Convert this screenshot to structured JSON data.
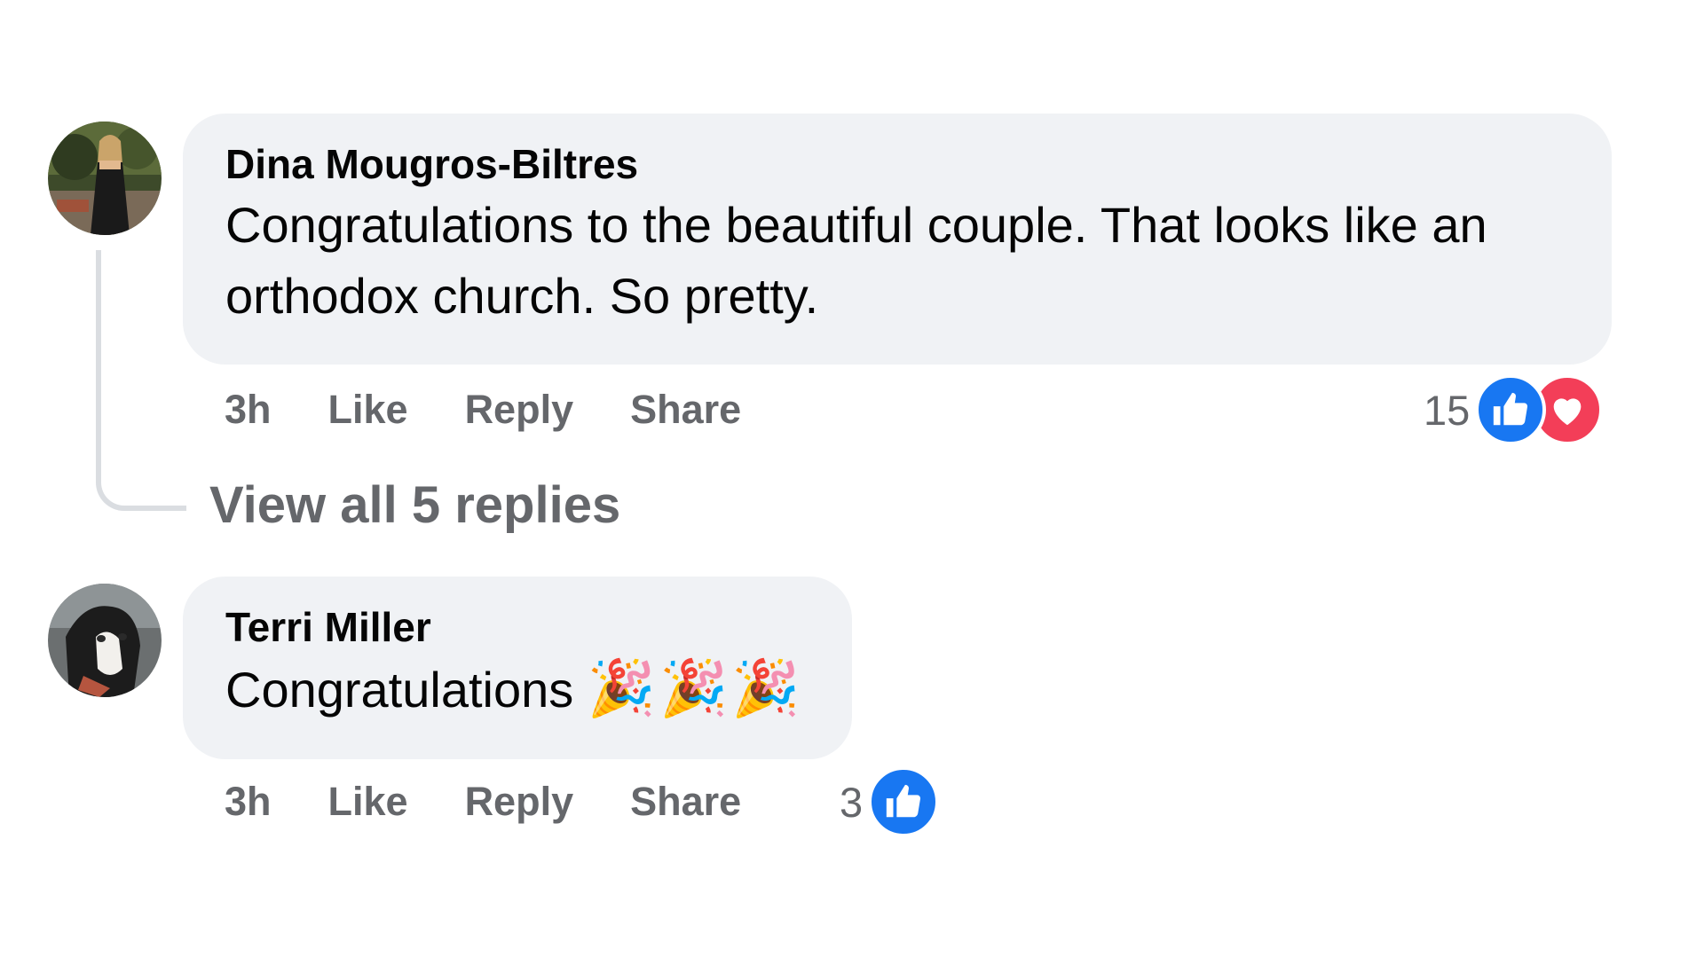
{
  "comments": [
    {
      "author": "Dina Mougros-Biltres",
      "text": "Congratulations to the beautiful couple. That looks like an orthodox church. So pretty.",
      "time": "3h",
      "actions": {
        "like": "Like",
        "reply": "Reply",
        "share": "Share"
      },
      "reaction_count": "15",
      "reactions": [
        "like-icon",
        "love-icon"
      ],
      "view_replies_label": "View all 5 replies"
    },
    {
      "author": "Terri Miller",
      "text": "Congratulations",
      "emoji": "🎉🎉🎉",
      "time": "3h",
      "actions": {
        "like": "Like",
        "reply": "Reply",
        "share": "Share"
      },
      "reaction_count": "3",
      "reactions": [
        "like-icon"
      ]
    }
  ],
  "colors": {
    "bubble": "#f0f2f5",
    "secondary_text": "#65676b",
    "like_blue": "#1877f2",
    "love_red": "#f33e58",
    "thread_line": "#dadde1"
  }
}
